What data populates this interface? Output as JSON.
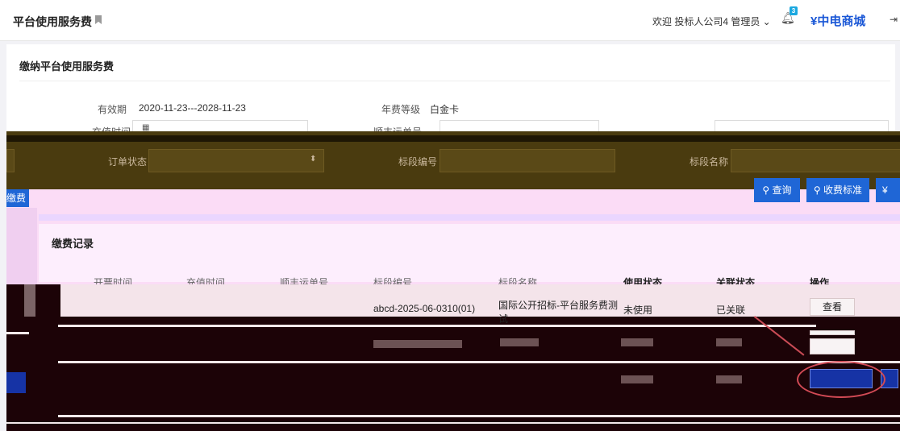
{
  "header": {
    "title": "平台使用服务费",
    "welcome": "欢迎 投标人公司4 管理员 ⌄",
    "notification_count": "3",
    "mall_label": "中电商城"
  },
  "page": {
    "section_title": "缴纳平台使用服务费",
    "validity_label": "有效期",
    "validity_value": "2020-11-23---2028-11-23",
    "level_label": "年费等级",
    "level_value": "白金卡",
    "recharge_time_label": "充值时间",
    "tracking_label": "顺丰运单号"
  },
  "filters": {
    "order_status_label": "订单状态",
    "section_no_label": "标段编号",
    "section_name_label": "标段名称"
  },
  "actions": {
    "query_label": "查询",
    "fee_standard_label": "收费标准",
    "pay_label": "缴费",
    "cart_partial": "¥"
  },
  "records": {
    "title": "缴费记录",
    "columns": [
      "开票时间",
      "充值时间",
      "顺丰运单号",
      "标段编号",
      "标段名称",
      "使用状态",
      "关联状态",
      "操作"
    ],
    "row1": {
      "section_no": "abcd-2025-06-0310(01)",
      "section_name": "国际公开招标-平台服务费测试",
      "use_status": "未使用",
      "link_status": "已关联",
      "op": "查看"
    }
  }
}
